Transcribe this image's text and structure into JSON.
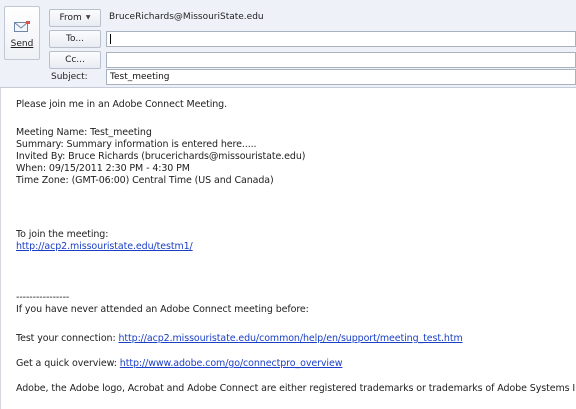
{
  "header": {
    "send_label": "Send",
    "from_label": "From",
    "from_address": "BruceRichards@MissouriState.edu",
    "to_label": "To...",
    "to_value": "",
    "cc_label": "Cc...",
    "cc_value": "",
    "subject_label": "Subject:",
    "subject_value": "Test_meeting"
  },
  "body": {
    "intro": "Please join me in an Adobe Connect Meeting.",
    "meeting_name": "Meeting Name:  Test_meeting",
    "summary": "Summary: Summary information is entered here.....",
    "invited_by": "Invited By: Bruce Richards (brucerichards@missouristate.edu)",
    "when": "When:  09/15/2011 2:30 PM - 4:30 PM",
    "time_zone": "Time Zone:  (GMT-06:00) Central Time (US and Canada)",
    "join_label": "To join the meeting:",
    "join_link": "http://acp2.missouristate.edu/testm1/",
    "divider": "----------------",
    "never_attended": "If you have never attended an Adobe Connect meeting before:",
    "test_connection_label": "Test your connection: ",
    "test_connection_link": "http://acp2.missouristate.edu/common/help/en/support/meeting_test.htm",
    "overview_label": "Get a quick overview: ",
    "overview_link": "http://www.adobe.com/go/connectpro_overview",
    "trademark": "Adobe, the Adobe logo, Acrobat and Adobe Connect are either registered trademarks or trademarks of Adobe Systems Incorporated"
  },
  "colors": {
    "link": "#1a3fc7",
    "header_bg": "#eef2f8"
  }
}
